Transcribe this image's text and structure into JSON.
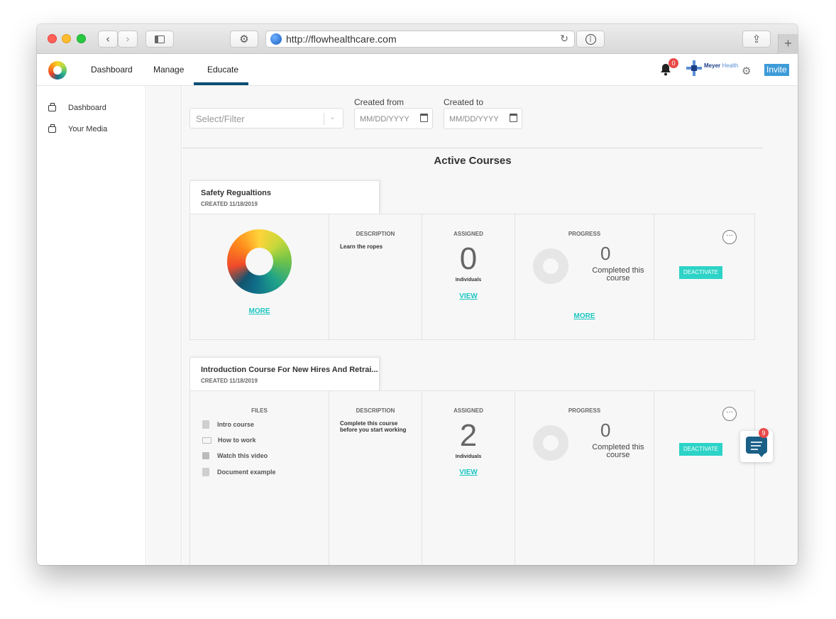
{
  "browser": {
    "url": "http://flowhealthcare.com"
  },
  "nav": {
    "links": [
      "Dashboard",
      "Manage",
      "Educate"
    ],
    "active": "Educate",
    "notification_count": "0",
    "org_name_bold": "Meyer",
    "org_name_light": "Health",
    "invite_label": "Invite"
  },
  "sidebar": {
    "items": [
      {
        "label": "Dashboard",
        "icon": "briefcase-icon"
      },
      {
        "label": "Your Media",
        "icon": "briefcase-icon"
      }
    ]
  },
  "filters": {
    "select_placeholder": "Select/Filter",
    "created_from_label": "Created from",
    "created_to_label": "Created to",
    "date_placeholder": "MM/DD/YYYY"
  },
  "section_title": "Active Courses",
  "courses": [
    {
      "title": "Safety Regualtions",
      "created": "CREATED 11/18/2019",
      "first_col_link": "MORE",
      "description_header": "DESCRIPTION",
      "description": "Learn the ropes",
      "assigned_header": "ASSIGNED",
      "assigned_count": "0",
      "assigned_unit": "Individuals",
      "assigned_link": "VIEW",
      "progress_header": "PROGRESS",
      "completed_count": "0",
      "completed_text": "Completed this course",
      "progress_link": "MORE",
      "menu_label": "···",
      "deactivate_label": "DEACTIVATE"
    },
    {
      "title": "Introduction Course For New Hires And Retrai...",
      "created": "CREATED 11/18/2019",
      "files_header": "FILES",
      "files": [
        {
          "name": "Intro course",
          "icon": "document-icon"
        },
        {
          "name": "How to work",
          "icon": "monitor-icon"
        },
        {
          "name": "Watch this video",
          "icon": "video-icon"
        },
        {
          "name": "Document example",
          "icon": "document-icon"
        }
      ],
      "description_header": "DESCRIPTION",
      "description": "Complete this course before you start working",
      "assigned_header": "ASSIGNED",
      "assigned_count": "2",
      "assigned_unit": "Individuals",
      "assigned_link": "VIEW",
      "progress_header": "PROGRESS",
      "completed_count": "0",
      "completed_text": "Completed this course",
      "menu_label": "···",
      "deactivate_label": "DEACTIVATE"
    }
  ],
  "chat": {
    "badge_count": "9"
  },
  "colors": {
    "accent_teal": "#2cd3c6",
    "nav_underline": "#0b4f74",
    "invite_blue": "#3d9bd8",
    "badge_red": "#e84a4a"
  }
}
